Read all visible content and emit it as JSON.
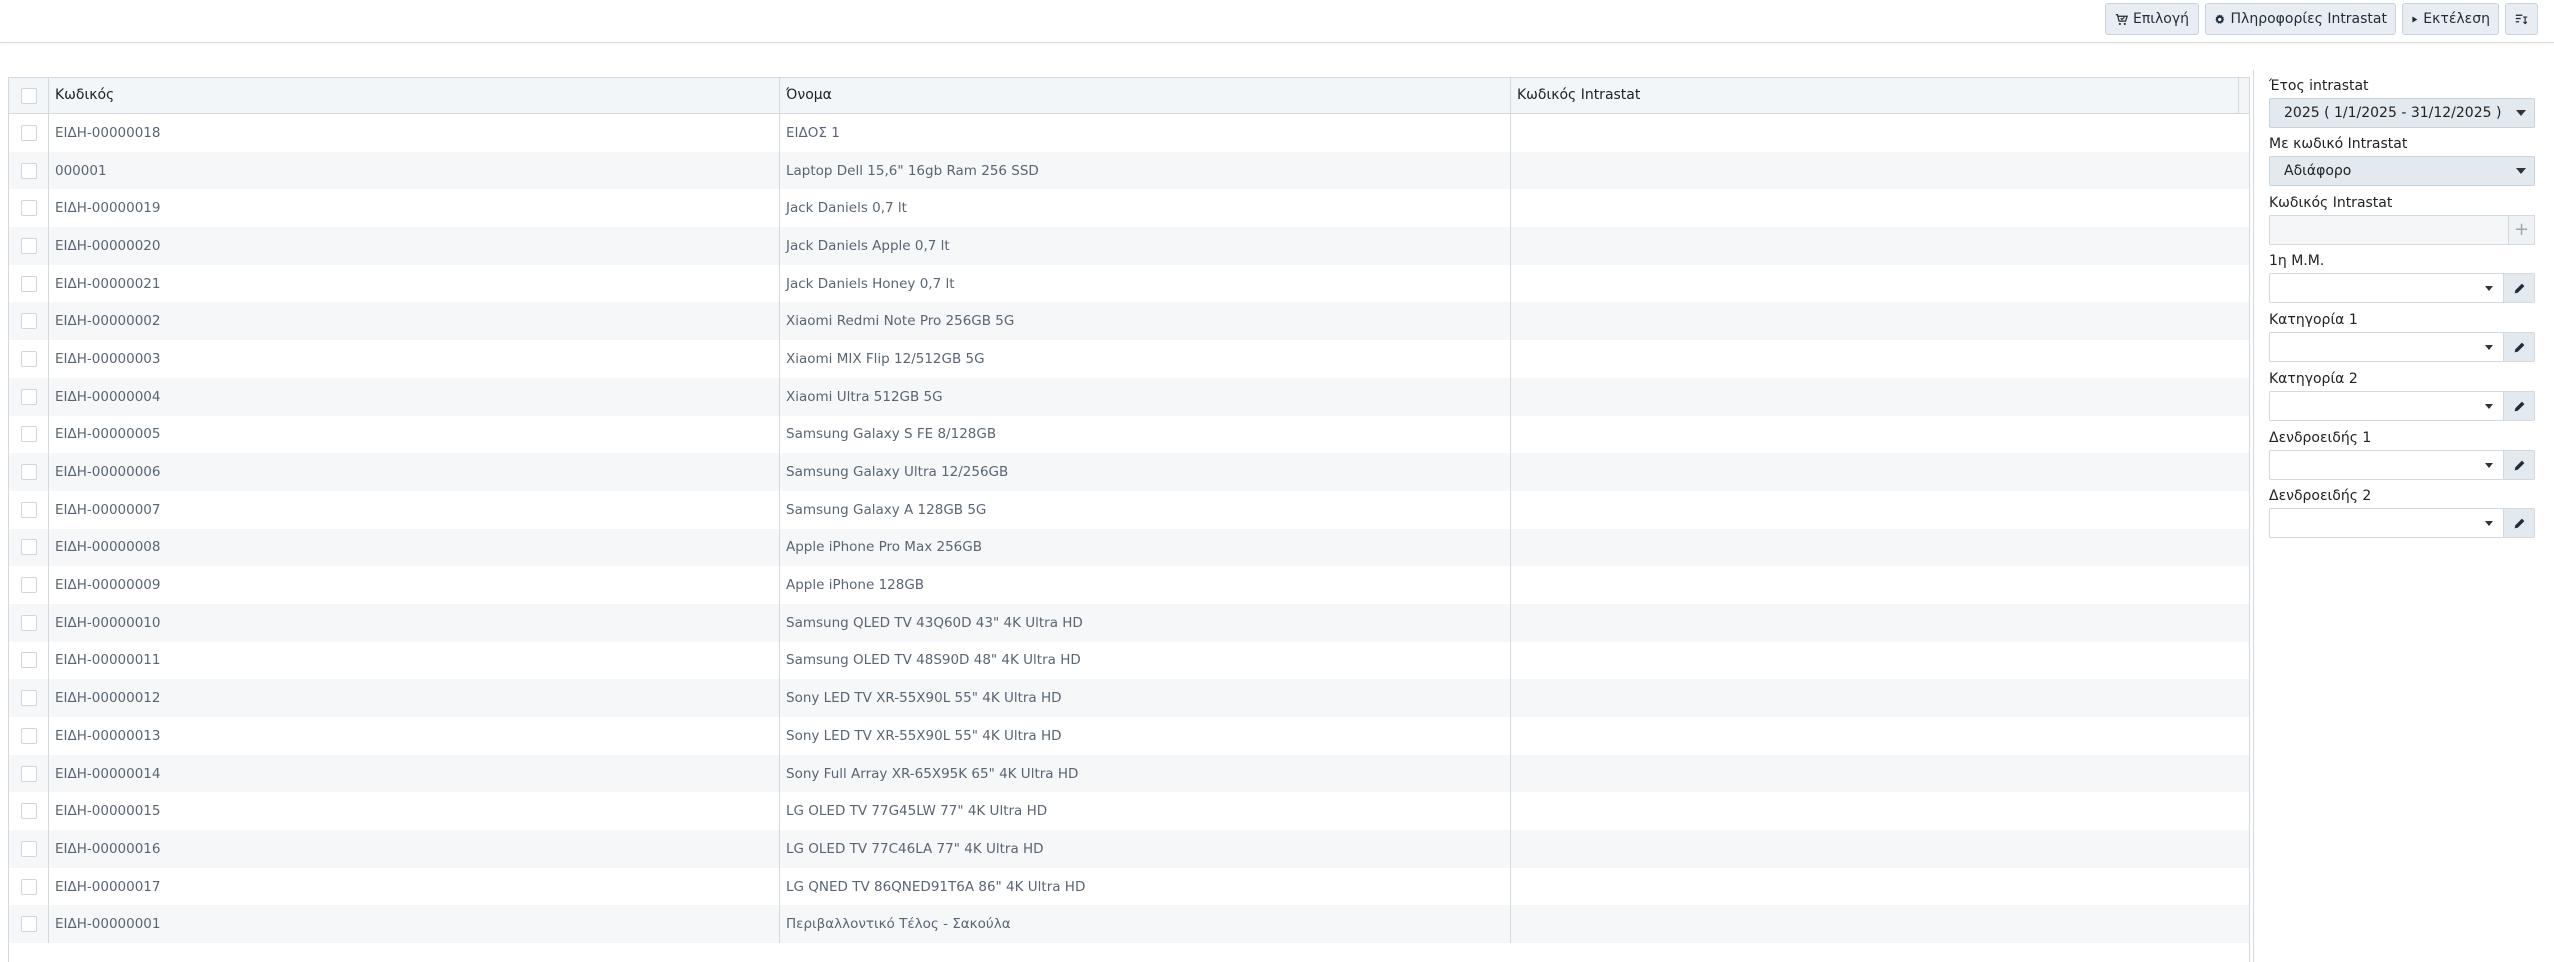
{
  "toolbar": {
    "select_label": "Επιλογή",
    "intrastat_info_label": "Πληροφορίες Intrastat",
    "execute_label": "Εκτέλεση"
  },
  "grid": {
    "columns": [
      "Κωδικός",
      "Όνομα",
      "Κωδικός Intrastat"
    ],
    "rows": [
      {
        "code": "ΕΙΔΗ-00000018",
        "name": "ΕΙΔΟΣ 1",
        "intrastat": ""
      },
      {
        "code": "000001",
        "name": "Laptop Dell 15,6\" 16gb Ram 256 SSD",
        "intrastat": ""
      },
      {
        "code": "ΕΙΔΗ-00000019",
        "name": "Jack Daniels 0,7 lt",
        "intrastat": ""
      },
      {
        "code": "ΕΙΔΗ-00000020",
        "name": "Jack Daniels Apple 0,7 lt",
        "intrastat": ""
      },
      {
        "code": "ΕΙΔΗ-00000021",
        "name": "Jack Daniels Honey 0,7 lt",
        "intrastat": ""
      },
      {
        "code": "ΕΙΔΗ-00000002",
        "name": "Xiaomi Redmi Note Pro 256GB 5G",
        "intrastat": ""
      },
      {
        "code": "ΕΙΔΗ-00000003",
        "name": "Xiaomi MIX Flip 12/512GB 5G",
        "intrastat": ""
      },
      {
        "code": "ΕΙΔΗ-00000004",
        "name": "Xiaomi Ultra 512GB 5G",
        "intrastat": ""
      },
      {
        "code": "ΕΙΔΗ-00000005",
        "name": "Samsung Galaxy S FE 8/128GB",
        "intrastat": ""
      },
      {
        "code": "ΕΙΔΗ-00000006",
        "name": "Samsung Galaxy Ultra 12/256GB",
        "intrastat": ""
      },
      {
        "code": "ΕΙΔΗ-00000007",
        "name": "Samsung Galaxy A 128GB 5G",
        "intrastat": ""
      },
      {
        "code": "ΕΙΔΗ-00000008",
        "name": "Apple iPhone Pro Max 256GB",
        "intrastat": ""
      },
      {
        "code": "ΕΙΔΗ-00000009",
        "name": "Apple iPhone 128GB",
        "intrastat": ""
      },
      {
        "code": "ΕΙΔΗ-00000010",
        "name": "Samsung QLED TV 43Q60D 43\" 4K Ultra HD",
        "intrastat": ""
      },
      {
        "code": "ΕΙΔΗ-00000011",
        "name": "Samsung OLED TV 48S90D 48\" 4K Ultra HD",
        "intrastat": ""
      },
      {
        "code": "ΕΙΔΗ-00000012",
        "name": "Sony LED TV XR-55X90L 55\" 4K Ultra HD",
        "intrastat": ""
      },
      {
        "code": "ΕΙΔΗ-00000013",
        "name": "Sony LED TV XR-55X90L 55\" 4K Ultra HD",
        "intrastat": ""
      },
      {
        "code": "ΕΙΔΗ-00000014",
        "name": "Sony Full Array XR-65X95K 65\" 4K Ultra HD",
        "intrastat": ""
      },
      {
        "code": "ΕΙΔΗ-00000015",
        "name": "LG OLED TV 77G45LW 77\" 4K Ultra HD",
        "intrastat": ""
      },
      {
        "code": "ΕΙΔΗ-00000016",
        "name": "LG OLED TV 77C46LA 77\" 4K Ultra HD",
        "intrastat": ""
      },
      {
        "code": "ΕΙΔΗ-00000017",
        "name": "LG QNED TV 86QNED91T6A 86\" 4K Ultra HD",
        "intrastat": ""
      },
      {
        "code": "ΕΙΔΗ-00000001",
        "name": "Περιβαλλοντικό Τέλος - Σακούλα",
        "intrastat": ""
      }
    ]
  },
  "filters": {
    "year_label": "Έτος intrastat",
    "year_value": "2025 ( 1/1/2025 - 31/12/2025 )",
    "with_code_label": "Με κωδικό Intrastat",
    "with_code_value": "Αδιάφορο",
    "code_label": "Κωδικός Intrastat",
    "uom_label": "1η Μ.Μ.",
    "category1_label": "Κατηγορία 1",
    "category2_label": "Κατηγορία 2",
    "tree1_label": "Δενδροειδής 1",
    "tree2_label": "Δενδροειδής 2"
  }
}
